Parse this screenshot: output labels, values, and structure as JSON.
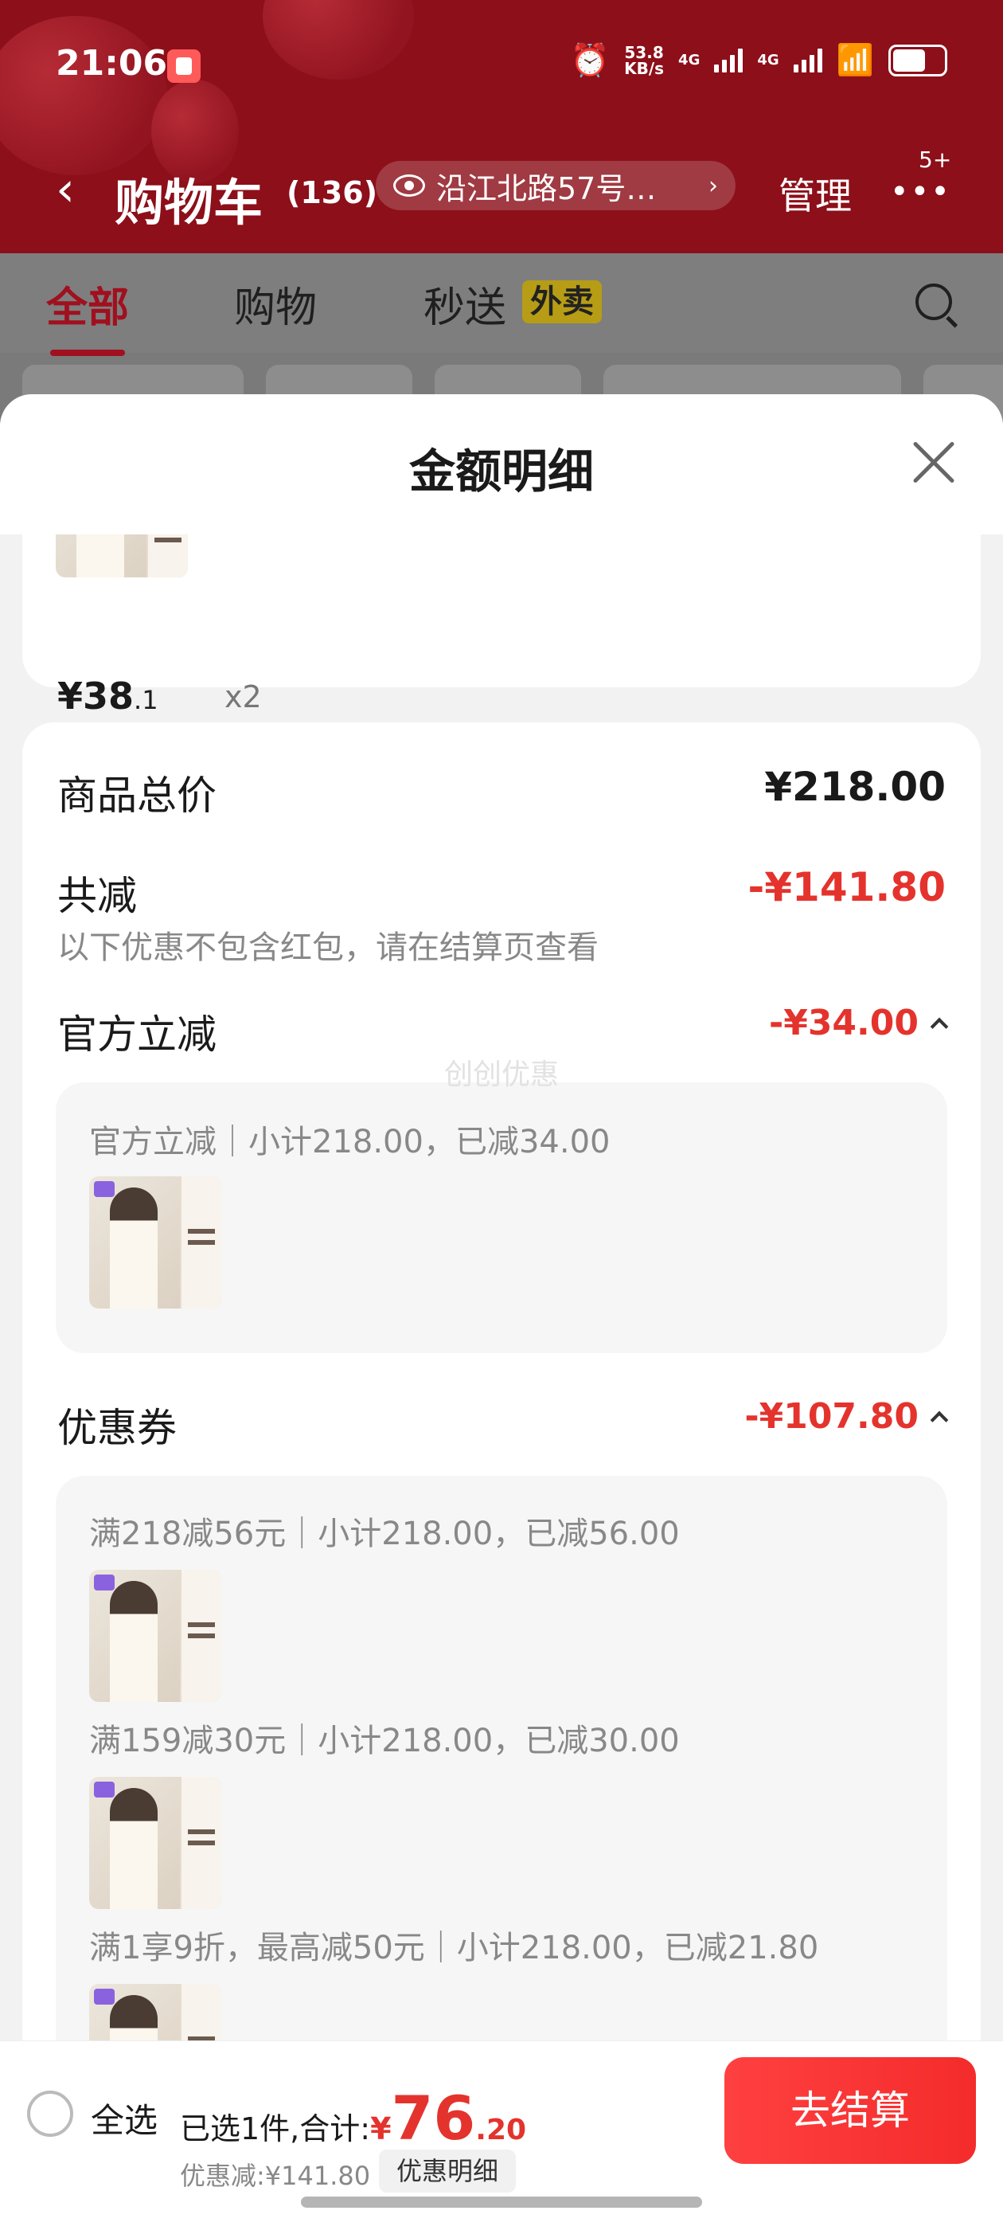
{
  "status_bar": {
    "time": "21:06",
    "speed_value": "53.8",
    "speed_unit": "KB/s",
    "net1": "4G",
    "net2": "4G"
  },
  "nav": {
    "title": "购物车",
    "count": "(136)",
    "address": "沿江北路57号…",
    "manage": "管理",
    "more": "•••",
    "more_badge": "5+"
  },
  "tabs": {
    "all": "全部",
    "shopping": "购物",
    "instant": "秒送",
    "takeout": "外卖"
  },
  "sheet": {
    "title": "金额明细",
    "top_item": {
      "price_int": "¥38",
      "price_dec": ".1",
      "qty": "x2"
    },
    "total_label": "商品总价",
    "total_value": "¥218.00",
    "reduce_label": "共减",
    "reduce_value": "-¥141.80",
    "reduce_hint": "以下优惠不包含红包，请在结算页查看",
    "official_label": "官方立减",
    "official_value": "-¥34.00",
    "official_line": "官方立减｜小计218.00，已减34.00",
    "watermark": "创创优惠",
    "coupon_label": "优惠券",
    "coupon_value": "-¥107.80",
    "coupon_lines": [
      "满218减56元｜小计218.00，已减56.00",
      "满159减30元｜小计218.00，已减30.00",
      "满1享9折，最高减50元｜小计218.00，已减21.80"
    ]
  },
  "bottom": {
    "select_all": "全选",
    "sum_prefix": "已选1件,合计:",
    "yen": "¥",
    "sum_int": "76",
    "sum_dec": ".20",
    "discount": "优惠减:¥141.80",
    "detail_button": "优惠明细",
    "checkout_button": "去结算"
  },
  "colors": {
    "accent": "#e4332d",
    "header_red": "#8c0f1a",
    "checkout": "#f42b2b"
  }
}
